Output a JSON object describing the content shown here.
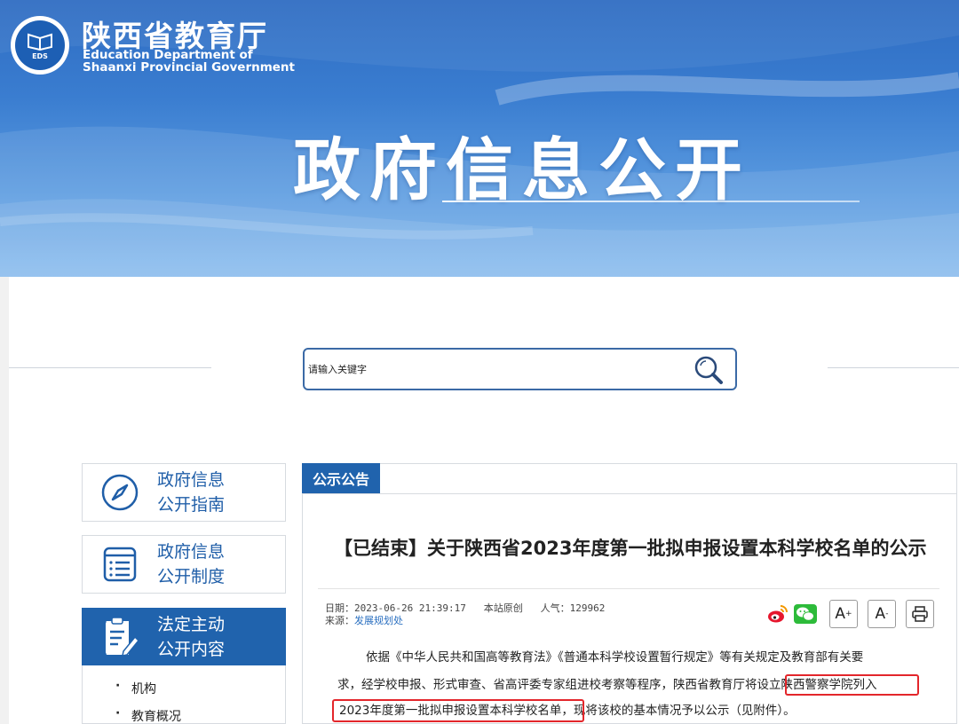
{
  "header": {
    "org_cn": "陕西省教育厅",
    "org_en_line1": "Education Department of",
    "org_en_line2": "Shaanxi Provincial Government",
    "emblem_text": "EDS",
    "banner_title": "政府信息公开"
  },
  "search": {
    "placeholder": "请输入关键字",
    "icon": "magnifier-icon"
  },
  "sidebar": {
    "items": [
      {
        "line1": "政府信息",
        "line2": "公开指南",
        "icon": "compass-icon",
        "active": false
      },
      {
        "line1": "政府信息",
        "line2": "公开制度",
        "icon": "document-list-icon",
        "active": false
      },
      {
        "line1": "法定主动",
        "line2": "公开内容",
        "icon": "edit-document-icon",
        "active": true
      }
    ],
    "sub_items": [
      "机构",
      "教育概况"
    ]
  },
  "content": {
    "tab_label": "公示公告",
    "title": "【已结束】关于陕西省2023年度第一批拟申报设置本科学校名单的公示",
    "meta": {
      "date_label": "日期：",
      "date": "2023-06-26 21:39:17",
      "origin": "本站原创",
      "views_label": "人气：",
      "views": "129962",
      "source_label": "来源：",
      "source": "发展规划处"
    },
    "tools": [
      "weibo-share-icon",
      "wechat-share-icon",
      "font-increase-button",
      "font-decrease-button",
      "print-icon"
    ],
    "font_plus_label": "A",
    "font_minus_label": "A",
    "paragraph_line1": "依据《中华人民共和国高等教育法》《普通本科学校设置暂行规定》等有关规定及教育部有关要",
    "paragraph_line2_a": "求，经学校申报、形式审查、省高评委专家组进校考察等程序，陕西省教育厅将",
    "paragraph_line2_b": "设立陕西警察学院列入",
    "paragraph_line3_a": "2023年度第一批拟申报设置本科学校名单",
    "paragraph_line3_b": "，现将该校的基本情况予以公示（见附件）。"
  },
  "colors": {
    "brand_blue": "#2063ad",
    "highlight_red": "#e3262b",
    "link_blue": "#2a6fc0"
  }
}
